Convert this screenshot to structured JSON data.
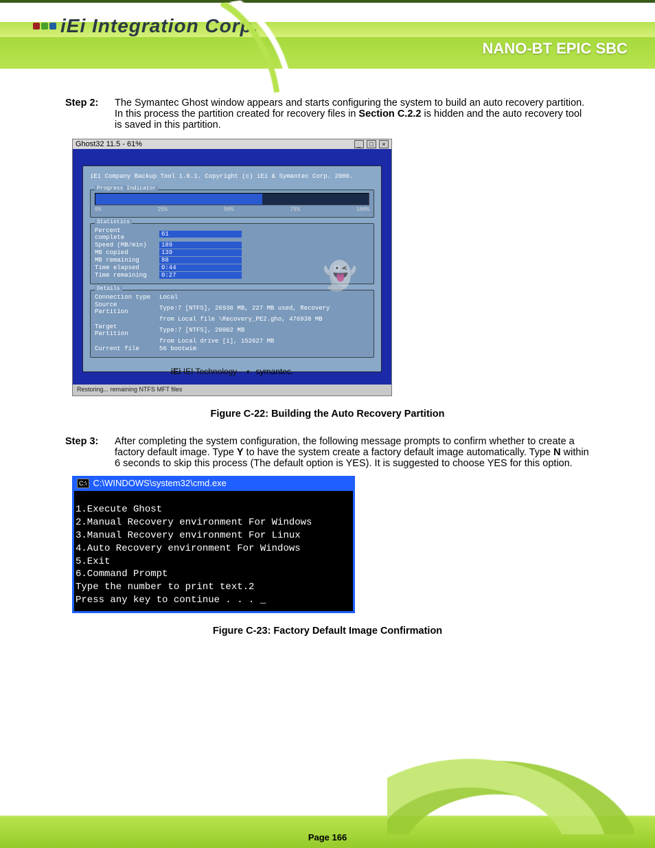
{
  "header": {
    "brand_prefix": "iEi",
    "brand_text": "Integration Corp.",
    "product": "NANO-BT EPIC SBC"
  },
  "steps_top": [
    {
      "id": "Step 2:",
      "html": "The Symantec Ghost window appears and starts configuring the system to build an auto recovery partition. In this process the partition created for recovery files in <b>Section C.2.2</b> is hidden and the auto recovery tool is saved in this partition."
    }
  ],
  "ghost": {
    "title": "Ghost32 11.5 - 61%",
    "caption": "iEi Company Backup Tool 1.0.1.  Copyright (c) iEi & Symantec Corp. 2000.",
    "progress": {
      "label": "Progress Indicator",
      "percent": 61,
      "ticks": [
        "0%",
        "25%",
        "50%",
        "75%",
        "100%"
      ]
    },
    "stats_label": "Statistics",
    "stats": [
      {
        "l": "Percent complete",
        "v": "61"
      },
      {
        "l": "Speed (MB/min)",
        "v": "189"
      },
      {
        "l": "MB copied",
        "v": "139"
      },
      {
        "l": "MB remaining",
        "v": "88"
      },
      {
        "l": "Time elapsed",
        "v": "0:44"
      },
      {
        "l": "Time remaining",
        "v": "0:27"
      }
    ],
    "details_label": "Details",
    "details": [
      {
        "l": "Connection type",
        "v": "Local"
      },
      {
        "l": "Source Partition",
        "v": "Type:7 [NTFS], 26936 MB, 227 MB used, Recovery"
      },
      {
        "l": "",
        "v": "from Local file \\Recovery_PE2.gho, 476938 MB"
      },
      {
        "l": "Target Partition",
        "v": "Type:7 [NTFS], 20002 MB"
      },
      {
        "l": "",
        "v": "from Local drive [1], 152627 MB"
      },
      {
        "l": "Current file",
        "v": "56 bootwim"
      }
    ],
    "footer_iei": "IEI Technology",
    "footer_sym": "symantec.",
    "status": "Restoring... remaining NTFS MFT files"
  },
  "caption1": "Figure C-22: Building the Auto Recovery Partition",
  "steps_mid": [
    {
      "id": "Step 3:",
      "html": "After completing the system configuration, the following message prompts to confirm whether to create a factory default image. Type <b>Y</b> to have the system create a factory default image automatically. Type <b>N</b> within 6 seconds to skip this process (The default option is YES). It is suggested to choose YES for this option."
    }
  ],
  "cmd": {
    "title": "C:\\WINDOWS\\system32\\cmd.exe",
    "lines": [
      "1.Execute Ghost",
      "2.Manual Recovery environment For Windows",
      "3.Manual Recovery environment For Linux",
      "4.Auto Recovery environment For Windows",
      "5.Exit",
      "6.Command Prompt",
      "Type the number to print text.2",
      "Press any key to continue . . . _"
    ]
  },
  "caption2": "Figure C-23: Factory Default Image Confirmation",
  "footer": {
    "page": "Page 166"
  }
}
